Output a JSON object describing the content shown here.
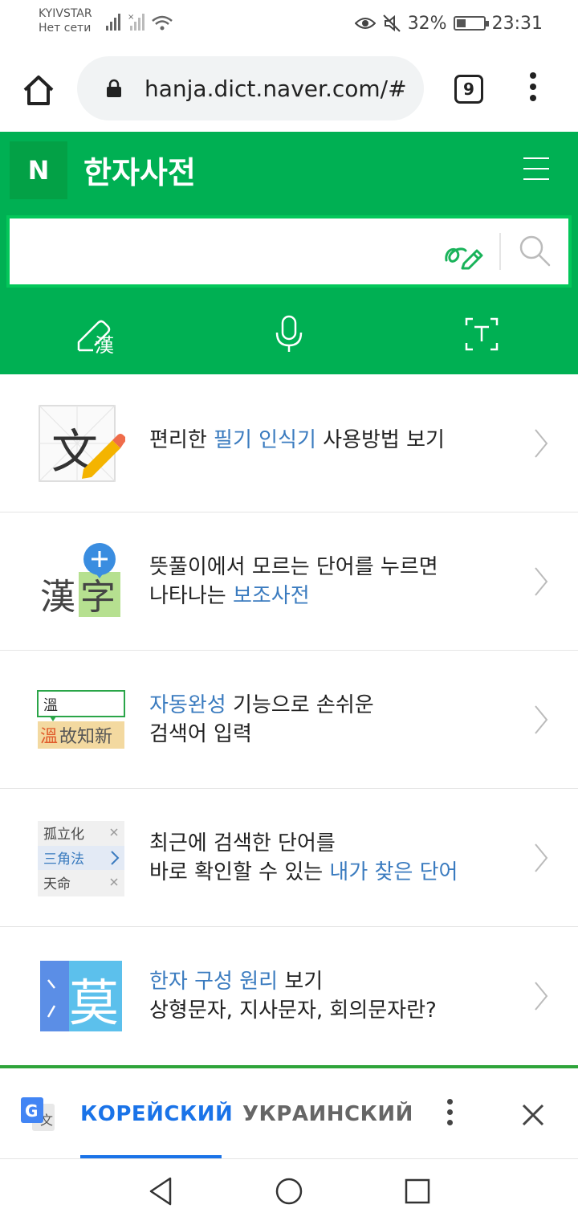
{
  "status": {
    "carrier": "KYIVSTAR",
    "network": "Нет сети",
    "battery": "32%",
    "time": "23:31"
  },
  "browser": {
    "url": "hanja.dict.naver.com/#",
    "tab_count": "9"
  },
  "header": {
    "logo": "N",
    "title": "한자사전"
  },
  "search": {
    "placeholder": ""
  },
  "features": [
    {
      "text_before": "편리한 ",
      "highlight": "필기 인식기",
      "text_after": " 사용방법 보기",
      "line2": ""
    },
    {
      "text_before": "뜻풀이에서 모르는 단어를 누르면",
      "highlight": "",
      "text_after": "",
      "line2_before": "나타나는 ",
      "line2_highlight": "보조사전"
    },
    {
      "highlight": "자동완성",
      "text_after": " 기능으로 손쉬운",
      "line2": "검색어 입력",
      "img_input": "溫",
      "img_suggest_hl": "溫",
      "img_suggest_rest": "故知新"
    },
    {
      "line1": "최근에 검색한 단어를",
      "line2_before": "바로 확인할 수 있는 ",
      "line2_highlight": "내가 찾은 단어",
      "img_words": [
        "孤立化",
        "三角法",
        "天命"
      ]
    },
    {
      "highlight": "한자 구성 원리",
      "text_after": " 보기",
      "line2": "상형문자, 지사문자, 회의문자란?",
      "img_char": "莫"
    }
  ],
  "feature_images": {
    "f1_char": "文",
    "f2_chars": [
      "漢",
      "字"
    ],
    "tool_hanja": "漢"
  },
  "translate": {
    "lang_source": "КОРЕЙСКИЙ",
    "lang_target": "УКРАИНСКИЙ"
  },
  "colors": {
    "naver_green": "#00b053",
    "link_blue": "#3a7bbf",
    "translate_blue": "#1a73e8"
  }
}
